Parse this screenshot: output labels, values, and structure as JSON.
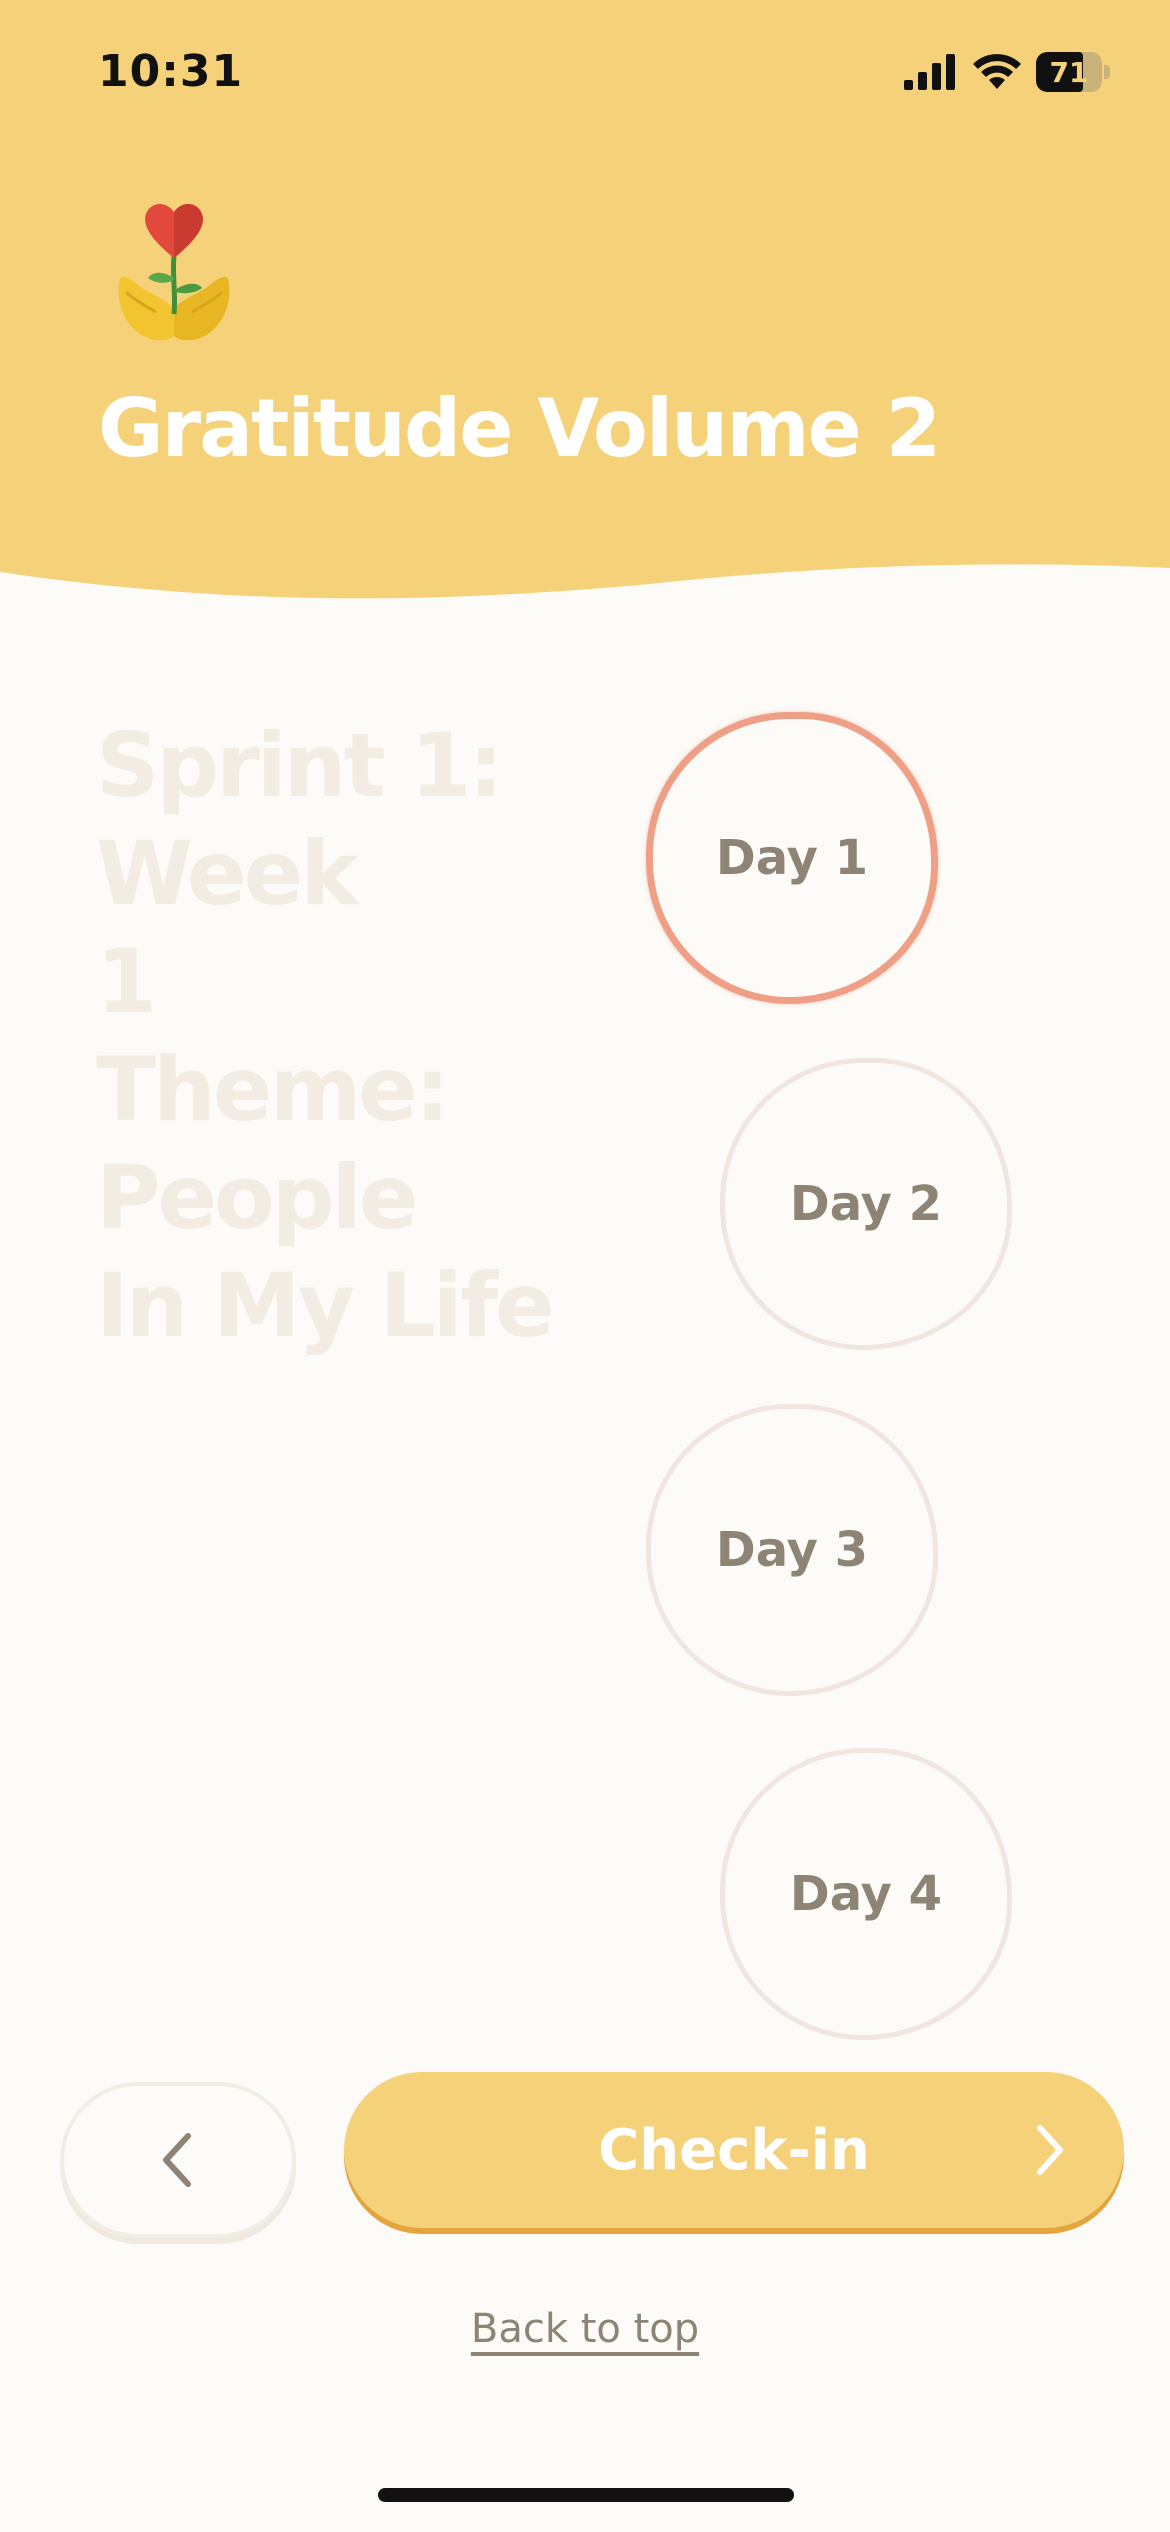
{
  "status_bar": {
    "time": "10:31",
    "battery": "71",
    "battery_level_percent": 71,
    "icons": [
      "cellular-signal-icon",
      "wifi-icon",
      "battery-icon"
    ]
  },
  "header": {
    "title": "Gratitude Volume 2",
    "logo_icon": "heart-plant-hands-icon",
    "background_color": "#f5d27a"
  },
  "sprint": {
    "heading": "Sprint 1: Week\n1\nTheme: People\nIn My Life"
  },
  "days": [
    {
      "label": "Day 1",
      "state": "active"
    },
    {
      "label": "Day 2",
      "state": "inactive"
    },
    {
      "label": "Day 3",
      "state": "inactive"
    },
    {
      "label": "Day 4",
      "state": "inactive"
    }
  ],
  "controls": {
    "back_icon": "chevron-left-icon",
    "checkin_label": "Check-in",
    "checkin_icon": "chevron-right-icon",
    "back_to_top": "Back to top"
  },
  "colors": {
    "accent_yellow": "#f5d27a",
    "active_ring": "#ee9f86",
    "muted_text": "#8d8475",
    "page_background": "#fdfbf7"
  }
}
